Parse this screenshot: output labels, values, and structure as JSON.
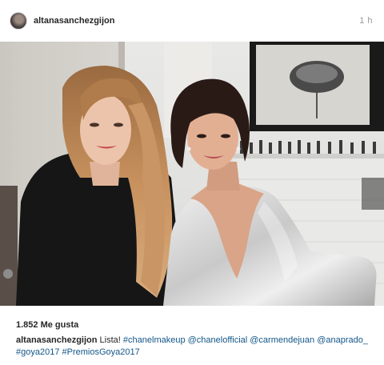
{
  "header": {
    "username": "altanasanchezgijon",
    "time": "1 h"
  },
  "photo": {
    "description_icon": "post-photo"
  },
  "likes": {
    "count_text": "1.852 Me gusta"
  },
  "caption": {
    "username": "altanasanchezgijon",
    "text": "Lista!",
    "tags": [
      "#chanelmakeup",
      "@chanelofficial",
      "@carmendejuan",
      "@anaprado_",
      "#goya2017",
      "#PremiosGoya2017"
    ]
  },
  "colors": {
    "link": "#125688",
    "text": "#262626",
    "muted": "#999999"
  }
}
